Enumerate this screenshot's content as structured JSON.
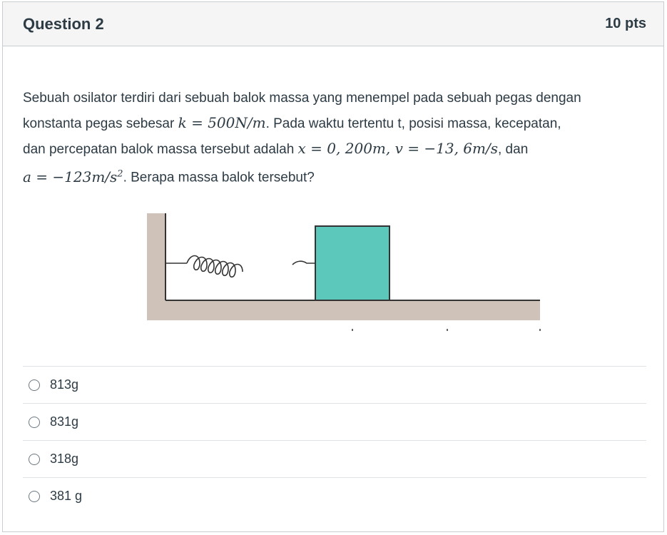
{
  "header": {
    "title": "Question 2",
    "points": "10 pts"
  },
  "question": {
    "line1": "Sebuah osilator terdiri dari sebuah balok massa yang menempel pada sebuah pegas dengan",
    "line2_pre": "konstanta pegas sebesar ",
    "k_expr": "k = 500N/m",
    "line2_post": ". Pada waktu tertentu t, posisi massa, kecepatan,",
    "line3_pre": "dan percepatan balok massa tersebut adalah ",
    "x_expr": "x = 0, 200m",
    "comma": ", ",
    "v_expr": "v = −13, 6m/s",
    "line3_post": ", dan",
    "a_expr": "a = −123m/s",
    "a_exp": "2",
    "line4_post": ". Berapa massa balok tersebut?"
  },
  "diagram": {
    "wall_color": "#cfc2b8",
    "block_color": "#5cc8bb",
    "spring": "spring-coil",
    "block": "mass-block"
  },
  "answers": [
    {
      "label": "813g"
    },
    {
      "label": "831g"
    },
    {
      "label": "318g"
    },
    {
      "label": "381 g"
    }
  ]
}
